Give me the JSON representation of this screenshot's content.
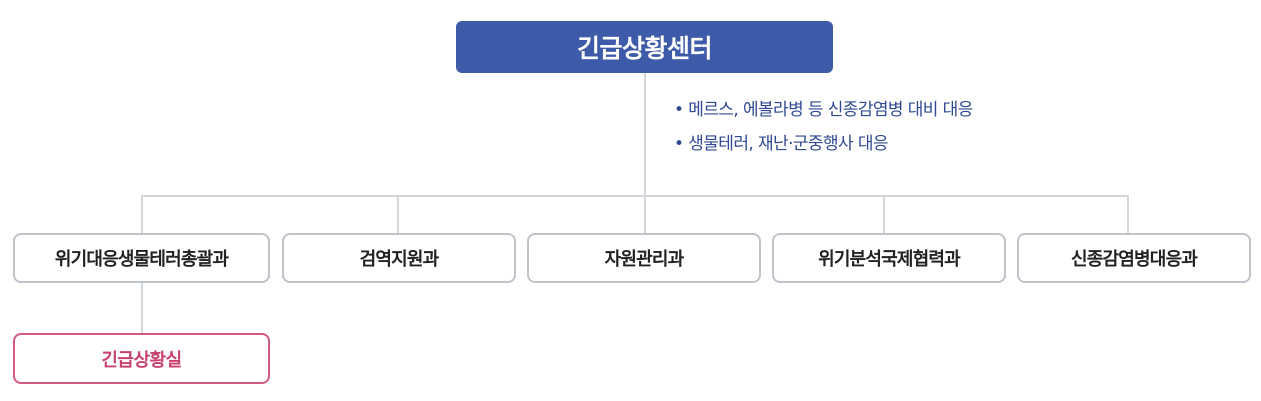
{
  "org": {
    "top": {
      "label": "긴급상황센터"
    },
    "notes": [
      "• 메르스, 에볼라병 등 신종감염병 대비 대응",
      "• 생물테러, 재난·군중행사 대응"
    ],
    "departments": [
      "위기대응생물테러총괄과",
      "검역지원과",
      "자원관리과",
      "위기분석국제협력과",
      "신종감염병대응과"
    ],
    "sub_unit": {
      "label": "긴급상황실"
    }
  },
  "colors": {
    "top_box": "#3d5ba8",
    "note_text": "#2f4a92",
    "dept_border": "#bfc4cb",
    "sub_border": "#d15a80",
    "sub_text": "#c8426e",
    "connector": "#d3d6db"
  }
}
